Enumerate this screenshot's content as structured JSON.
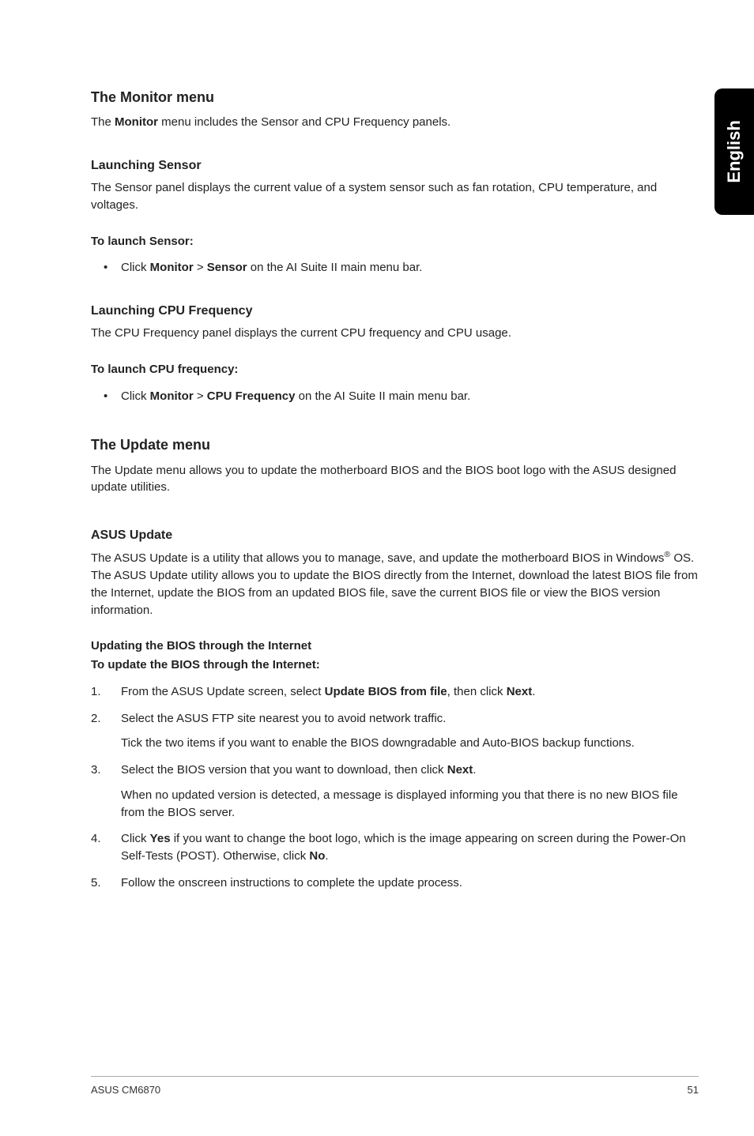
{
  "sideTab": "English",
  "monitorMenu": {
    "title": "The Monitor menu",
    "intro_pre": "The ",
    "intro_bold": "Monitor",
    "intro_post": " menu includes the Sensor and CPU Frequency panels.",
    "launchSensor": {
      "title": "Launching Sensor",
      "desc": "The Sensor panel displays the current value of a system sensor such as fan rotation, CPU temperature, and voltages.",
      "toLaunch": "To launch Sensor:",
      "bullet_pre": "Click ",
      "bullet_b1": "Monitor",
      "bullet_mid": " > ",
      "bullet_b2": "Sensor",
      "bullet_post": " on the AI Suite II main menu bar."
    },
    "launchCpu": {
      "title": "Launching CPU Frequency",
      "desc": "The CPU Frequency panel displays the current CPU frequency and CPU usage.",
      "toLaunch": "To launch CPU frequency:",
      "bullet_pre": "Click ",
      "bullet_b1": "Monitor",
      "bullet_mid": " > ",
      "bullet_b2": "CPU Frequency",
      "bullet_post": " on the AI Suite II main menu bar."
    }
  },
  "updateMenu": {
    "title": "The Update menu",
    "intro": "The Update menu allows you to update the motherboard BIOS and the BIOS boot logo with the ASUS designed update utilities.",
    "asusUpdate": {
      "title": "ASUS Update",
      "desc_1": "The ASUS Update is a utility that allows you to manage, save, and update the motherboard BIOS in Windows",
      "desc_sup": "®",
      "desc_2": " OS. The ASUS Update utility allows you to update the BIOS directly from the Internet, download the latest BIOS file from the Internet, update the BIOS from an updated BIOS file, save the current BIOS file or view the BIOS version information.",
      "updInternetTitle": "Updating the BIOS through the Internet",
      "toUpdate": "To update the BIOS through the Internet:",
      "steps": [
        {
          "num": "1.",
          "pre": "From the ASUS Update screen, select ",
          "b1": "Update BIOS from file",
          "mid": ", then click ",
          "b2": "Next",
          "post": "."
        },
        {
          "num": "2.",
          "text": "Select the ASUS FTP site nearest you to avoid network traffic.",
          "sub": "Tick the two items if you want to enable the BIOS downgradable and Auto-BIOS backup functions."
        },
        {
          "num": "3.",
          "pre": "Select the BIOS version that you want to download, then click ",
          "b1": "Next",
          "post": ".",
          "sub": "When no updated version is detected, a message is displayed informing you that there is no new BIOS file from the BIOS server."
        },
        {
          "num": "4.",
          "pre": "Click ",
          "b1": "Yes",
          "mid": " if you want to change the boot logo, which is the image appearing on screen during the Power-On Self-Tests (POST). Otherwise, click ",
          "b2": "No",
          "post": "."
        },
        {
          "num": "5.",
          "text": "Follow the onscreen instructions to complete the update process."
        }
      ]
    }
  },
  "footer": {
    "left": "ASUS CM6870",
    "right": "51"
  }
}
